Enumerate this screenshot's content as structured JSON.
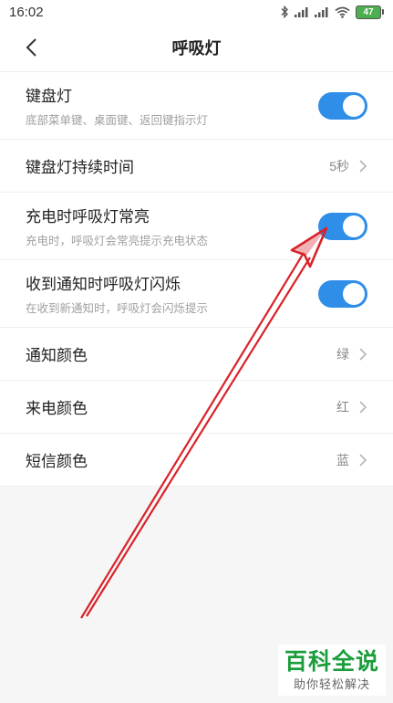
{
  "status_bar": {
    "time": "16:02",
    "battery_level": "47",
    "icons": [
      "bluetooth-icon",
      "signal-icon",
      "signal-icon",
      "wifi-icon",
      "battery-icon"
    ]
  },
  "header": {
    "title": "呼吸灯",
    "back_icon": "chevron-left-icon"
  },
  "settings": [
    {
      "title": "键盘灯",
      "subtitle": "底部菜单键、桌面键、返回键指示灯",
      "type": "toggle",
      "on": true
    },
    {
      "title": "键盘灯持续时间",
      "value": "5秒",
      "type": "value"
    },
    {
      "title": "充电时呼吸灯常亮",
      "subtitle": "充电时，呼吸灯会常亮提示充电状态",
      "type": "toggle",
      "on": true
    },
    {
      "title": "收到通知时呼吸灯闪烁",
      "subtitle": "在收到新通知时，呼吸灯会闪烁提示",
      "type": "toggle",
      "on": true
    },
    {
      "title": "通知颜色",
      "value": "绿",
      "type": "value"
    },
    {
      "title": "来电颜色",
      "value": "红",
      "type": "value"
    },
    {
      "title": "短信颜色",
      "value": "蓝",
      "type": "value"
    }
  ],
  "annotation": {
    "color": "#d8232a"
  },
  "watermark": {
    "title": "百科全说",
    "subtitle": "助你轻松解决"
  },
  "colors": {
    "accent": "#2e8ee8",
    "watermark_green": "#1a9d3b"
  }
}
